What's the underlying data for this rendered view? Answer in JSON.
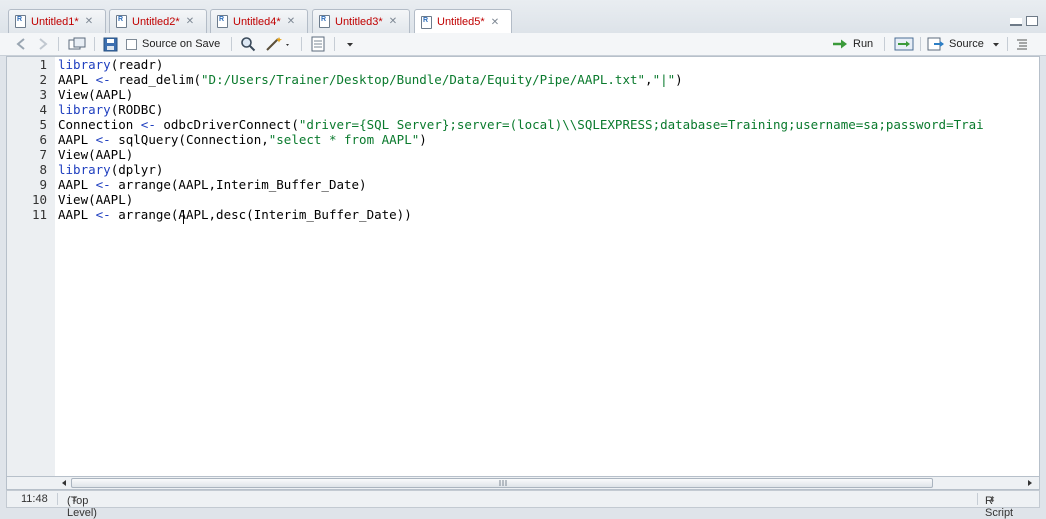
{
  "tabs": [
    {
      "label": "Untitled1*",
      "active": false
    },
    {
      "label": "Untitled2*",
      "active": false
    },
    {
      "label": "Untitled4*",
      "active": false
    },
    {
      "label": "Untitled3*",
      "active": false
    },
    {
      "label": "Untitled5*",
      "active": true
    }
  ],
  "toolbar": {
    "source_on_save_label": "Source on Save",
    "run_label": "Run",
    "source_label": "Source"
  },
  "editor": {
    "lines": [
      {
        "n": "1",
        "tokens": [
          {
            "t": "library",
            "c": "kw"
          },
          {
            "t": "(readr)",
            "c": ""
          }
        ]
      },
      {
        "n": "2",
        "tokens": [
          {
            "t": "AAPL ",
            "c": ""
          },
          {
            "t": "<-",
            "c": "op"
          },
          {
            "t": " read_delim(",
            "c": ""
          },
          {
            "t": "\"D:/Users/Trainer/Desktop/Bundle/Data/Equity/Pipe/AAPL.txt\"",
            "c": "str"
          },
          {
            "t": ",",
            "c": ""
          },
          {
            "t": "\"|\"",
            "c": "str"
          },
          {
            "t": ")",
            "c": ""
          }
        ]
      },
      {
        "n": "3",
        "tokens": [
          {
            "t": "View(AAPL)",
            "c": ""
          }
        ]
      },
      {
        "n": "4",
        "tokens": [
          {
            "t": "library",
            "c": "kw"
          },
          {
            "t": "(RODBC)",
            "c": ""
          }
        ]
      },
      {
        "n": "5",
        "tokens": [
          {
            "t": "Connection ",
            "c": ""
          },
          {
            "t": "<-",
            "c": "op"
          },
          {
            "t": " odbcDriverConnect(",
            "c": ""
          },
          {
            "t": "\"driver={SQL Server};server=(local)\\\\SQLEXPRESS;database=Training;username=sa;password=Trai",
            "c": "str"
          }
        ]
      },
      {
        "n": "6",
        "tokens": [
          {
            "t": "AAPL ",
            "c": ""
          },
          {
            "t": "<-",
            "c": "op"
          },
          {
            "t": " sqlQuery(Connection,",
            "c": ""
          },
          {
            "t": "\"select * from AAPL\"",
            "c": "str"
          },
          {
            "t": ")",
            "c": ""
          }
        ]
      },
      {
        "n": "7",
        "tokens": [
          {
            "t": "View(AAPL)",
            "c": ""
          }
        ]
      },
      {
        "n": "8",
        "tokens": [
          {
            "t": "library",
            "c": "kw"
          },
          {
            "t": "(dplyr)",
            "c": ""
          }
        ]
      },
      {
        "n": "9",
        "tokens": [
          {
            "t": "AAPL ",
            "c": ""
          },
          {
            "t": "<-",
            "c": "op"
          },
          {
            "t": " arrange(AAPL,Interim_Buffer_Date)",
            "c": ""
          }
        ]
      },
      {
        "n": "10",
        "tokens": [
          {
            "t": "View(AAPL)",
            "c": ""
          }
        ]
      },
      {
        "n": "11",
        "tokens": [
          {
            "t": "AAPL ",
            "c": ""
          },
          {
            "t": "<-",
            "c": "op"
          },
          {
            "t": " arrange(AAPL,desc(Interim_Buffer_Date))",
            "c": ""
          }
        ]
      }
    ]
  },
  "status": {
    "cursor_position": "11:48",
    "scope": "(Top Level)",
    "file_type": "R Script"
  },
  "colors": {
    "tab_text": "#c00000",
    "keyword": "#1f3fbf",
    "string": "#0a7a2d"
  }
}
